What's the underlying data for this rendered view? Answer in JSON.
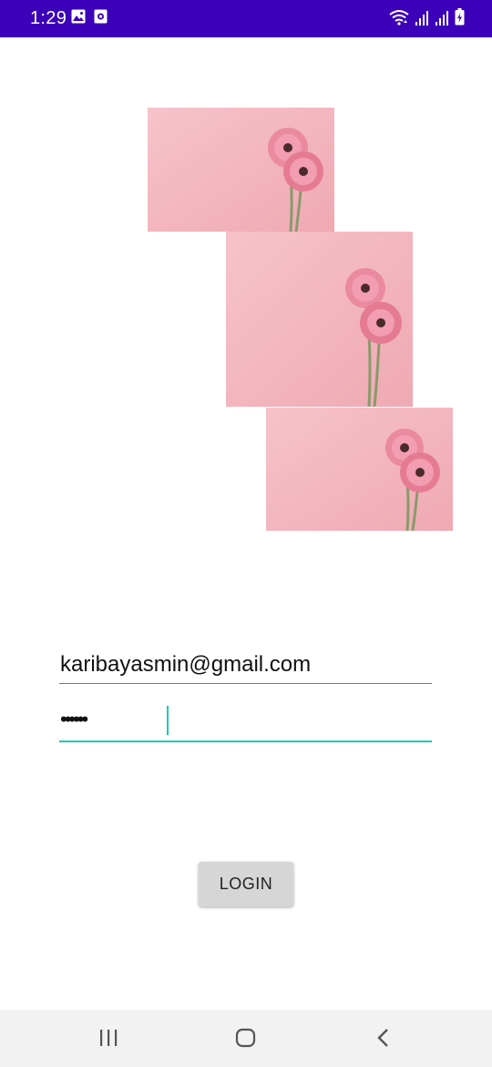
{
  "status_bar": {
    "time": "1:29",
    "background_color": "#3b00b8",
    "left_icons": [
      "gallery-icon",
      "screen-recorder-icon"
    ],
    "right_icons": [
      "wifi-icon",
      "signal-icon",
      "signal-icon",
      "battery-charging-icon"
    ]
  },
  "images": [
    {
      "name": "pink-gerbera-photo",
      "colors": [
        "#f5b8c0",
        "#e57b93"
      ]
    },
    {
      "name": "pink-gerbera-photo",
      "colors": [
        "#f5b8c0",
        "#e57b93"
      ]
    },
    {
      "name": "pink-gerbera-photo",
      "colors": [
        "#f5b8c0",
        "#e57b93"
      ]
    }
  ],
  "form": {
    "email": {
      "value": "karibayasmin@gmail.com"
    },
    "password": {
      "masked_value": "••••••",
      "focus_color": "#18c9b8"
    }
  },
  "login_button": {
    "label": "LOGIN"
  },
  "nav_bar": {
    "icons": [
      "recent-apps-icon",
      "home-icon",
      "back-icon"
    ]
  }
}
